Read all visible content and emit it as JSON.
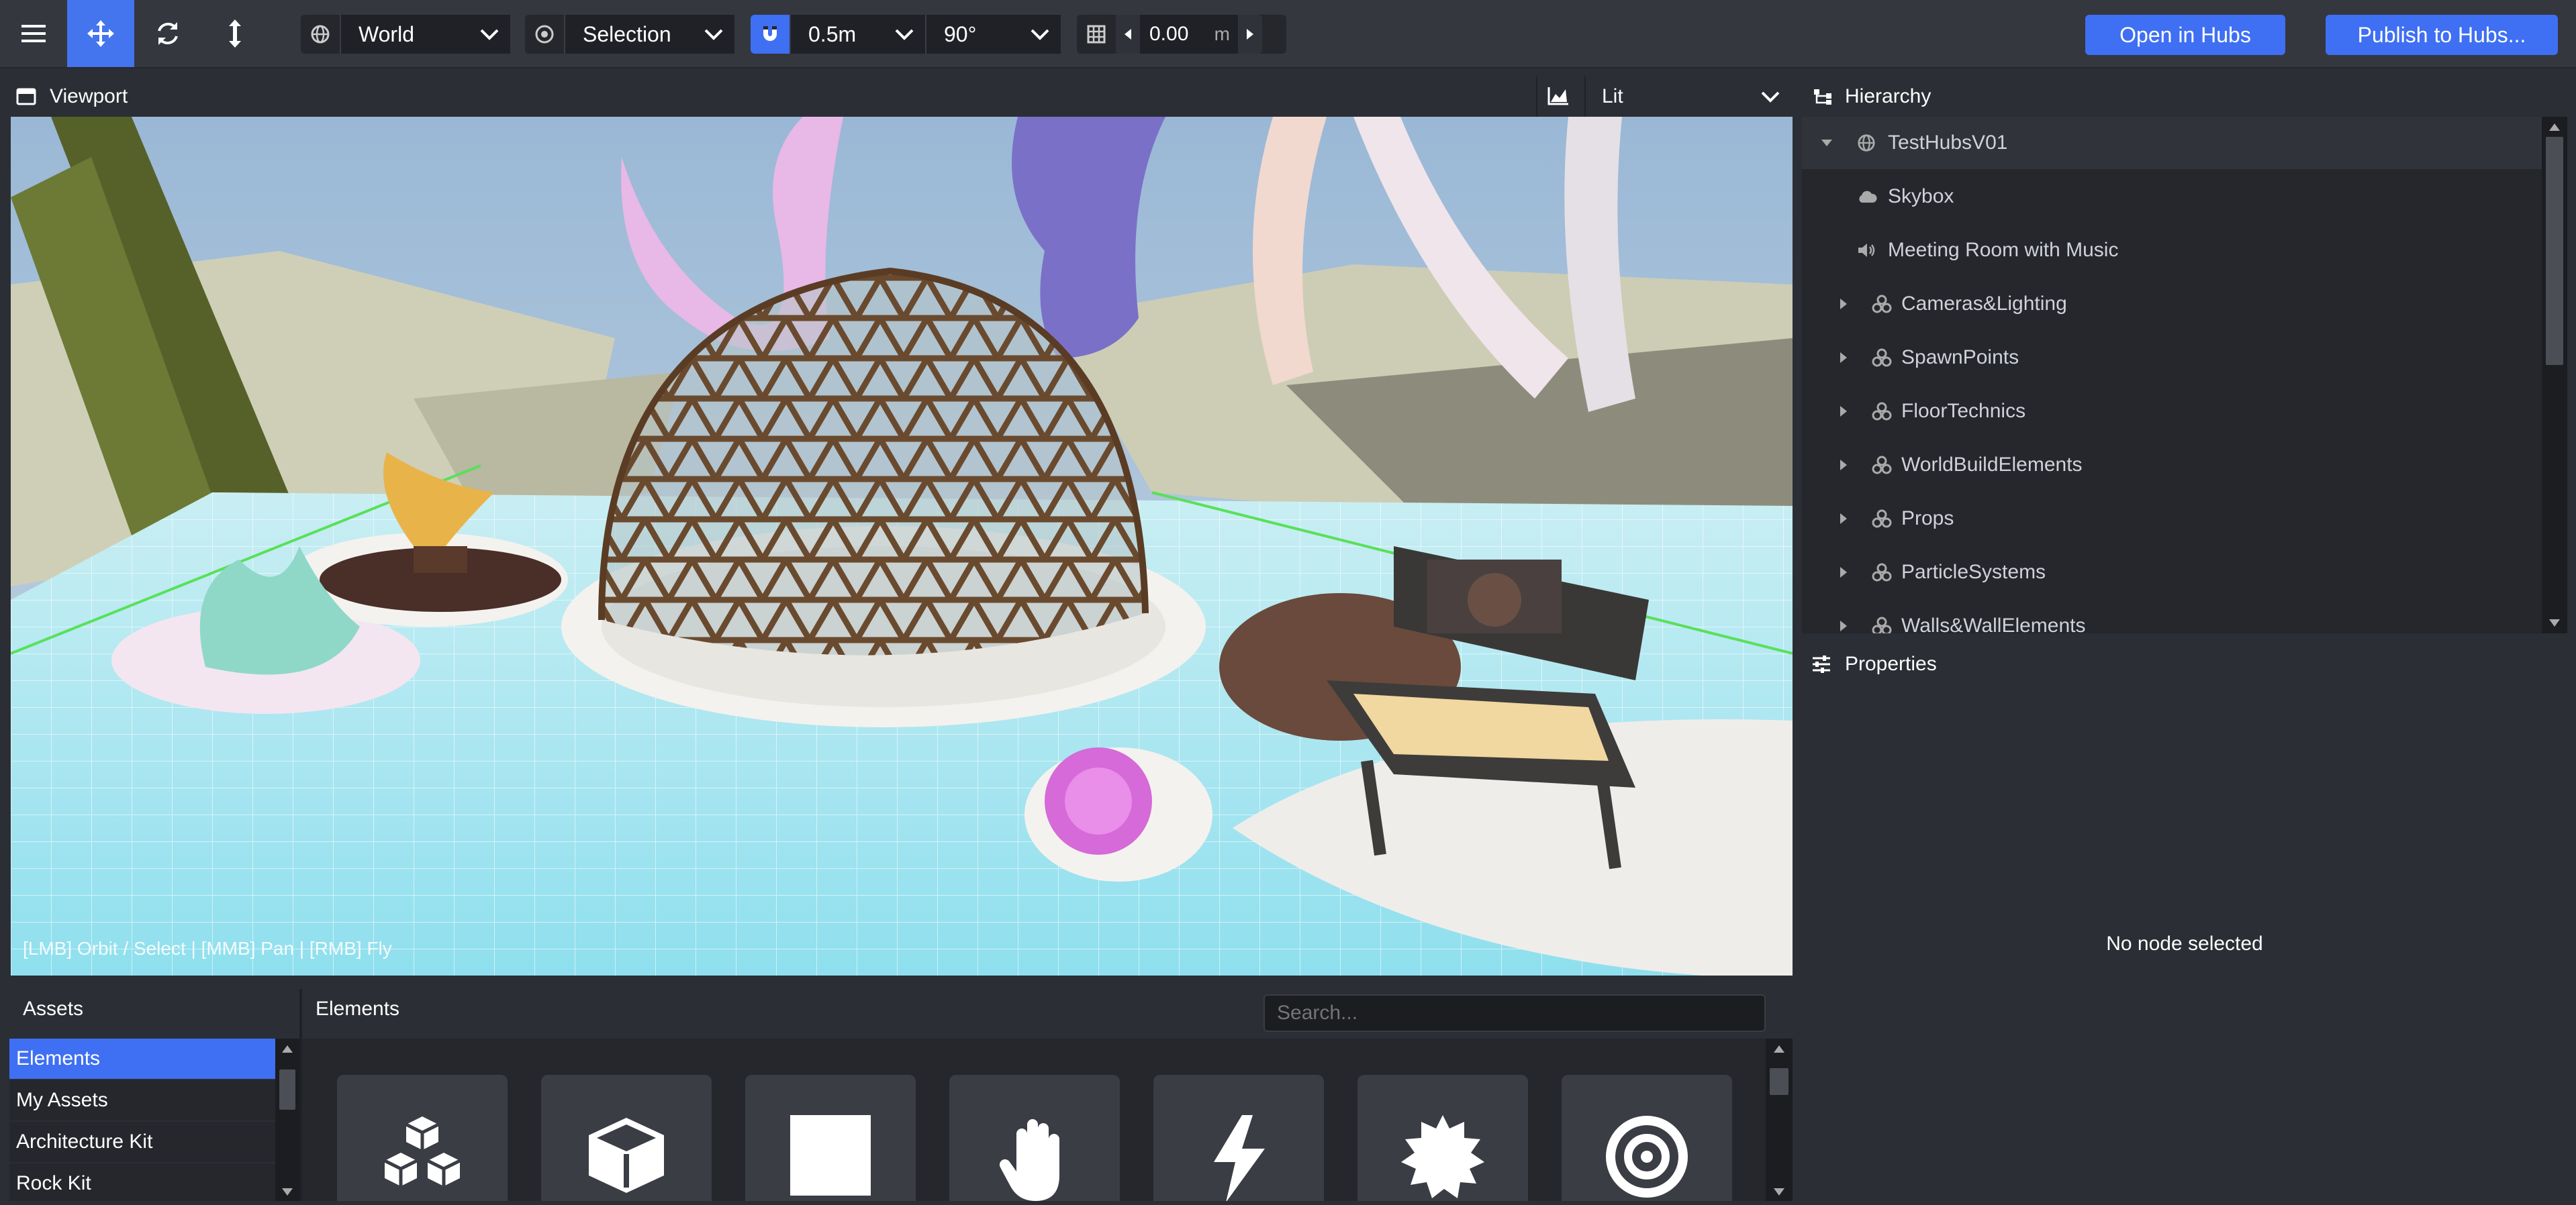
{
  "toolbar": {
    "transform_space": "World",
    "pivot_mode": "Selection",
    "snap_translate": "0.5m",
    "snap_rotate": "90°",
    "grid_height": "0.00",
    "grid_unit": "m",
    "open_in_hubs": "Open in Hubs",
    "publish": "Publish to Hubs..."
  },
  "viewport": {
    "title": "Viewport",
    "render_mode": "Lit",
    "hint": "[LMB] Orbit / Select | [MMB] Pan | [RMB] Fly"
  },
  "hierarchy": {
    "title": "Hierarchy",
    "items": [
      {
        "label": "TestHubsV01",
        "icon": "globe-icon"
      },
      {
        "label": "Skybox",
        "icon": "cloud-icon"
      },
      {
        "label": "Meeting Room with Music",
        "icon": "speaker-icon"
      },
      {
        "label": "Cameras&Lighting",
        "icon": "group-icon"
      },
      {
        "label": "SpawnPoints",
        "icon": "group-icon"
      },
      {
        "label": "FloorTechnics",
        "icon": "group-icon"
      },
      {
        "label": "WorldBuildElements",
        "icon": "group-icon"
      },
      {
        "label": "Props",
        "icon": "group-icon"
      },
      {
        "label": "ParticleSystems",
        "icon": "group-icon"
      },
      {
        "label": "Walls&WallElements",
        "icon": "group-icon"
      }
    ]
  },
  "properties": {
    "title": "Properties",
    "empty": "No node selected"
  },
  "assets": {
    "title": "Assets",
    "sources": [
      "Elements",
      "My Assets",
      "Architecture Kit",
      "Rock Kit"
    ]
  },
  "elements": {
    "title": "Elements",
    "search_placeholder": "Search...",
    "tiles": [
      "cubes-icon",
      "box-icon",
      "square-icon",
      "hand-icon",
      "bolt-icon",
      "burst-icon",
      "target-icon"
    ]
  },
  "colors": {
    "accent": "#3f6ff3",
    "panel": "#25272c",
    "background": "#2b2e35"
  }
}
